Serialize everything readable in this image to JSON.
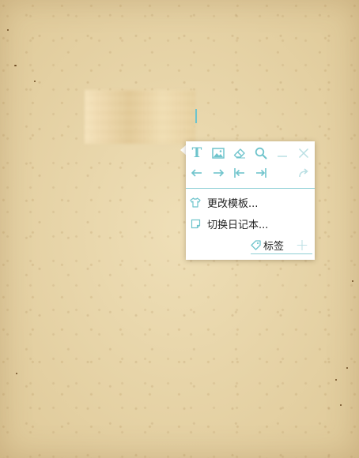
{
  "colors": {
    "accent": "#6fc4cc",
    "accent_muted": "#b9dfe3",
    "paper": "#e6d3a6",
    "popup_bg": "#ffffff",
    "text": "#222222"
  },
  "toolbar": {
    "row1": [
      {
        "icon": "text-format-icon",
        "label": "T"
      },
      {
        "icon": "image-icon"
      },
      {
        "icon": "eraser-icon"
      },
      {
        "icon": "search-icon"
      },
      {
        "icon": "minimize-icon"
      },
      {
        "icon": "close-icon"
      }
    ],
    "row2": [
      {
        "icon": "arrow-left-icon"
      },
      {
        "icon": "arrow-right-icon"
      },
      {
        "icon": "align-left-icon"
      },
      {
        "icon": "align-right-icon"
      },
      {
        "icon": "redo-icon"
      }
    ]
  },
  "menu": {
    "change_template": "更改模板...",
    "switch_diary": "切换日记本..."
  },
  "tags": {
    "label": "标签",
    "add_symbol": "+"
  }
}
